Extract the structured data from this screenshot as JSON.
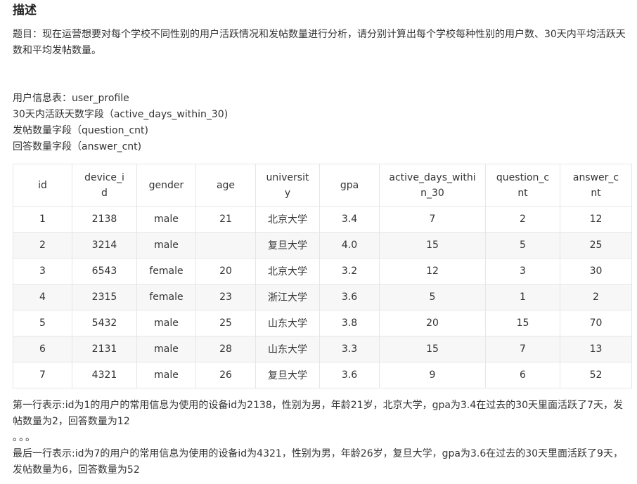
{
  "heading": "描述",
  "intro": "题目：现在运营想要对每个学校不同性别的用户活跃情况和发帖数量进行分析，请分别计算出每个学校每种性别的用户数、30天内平均活跃天数和平均发帖数量。",
  "info": {
    "line1": "用户信息表：user_profile",
    "line2": "30天内活跃天数字段（active_days_within_30)",
    "line3": "发帖数量字段（question_cnt)",
    "line4": "回答数量字段（answer_cnt)"
  },
  "table": {
    "headers": [
      "id",
      "device_id",
      "gender",
      "age",
      "university",
      "gpa",
      "active_days_within_30",
      "question_cnt",
      "answer_cnt"
    ],
    "rows": [
      [
        "1",
        "2138",
        "male",
        "21",
        "北京大学",
        "3.4",
        "7",
        "2",
        "12"
      ],
      [
        "2",
        "3214",
        "male",
        "",
        "复旦大学",
        "4.0",
        "15",
        "5",
        "25"
      ],
      [
        "3",
        "6543",
        "female",
        "20",
        "北京大学",
        "3.2",
        "12",
        "3",
        "30"
      ],
      [
        "4",
        "2315",
        "female",
        "23",
        "浙江大学",
        "3.6",
        "5",
        "1",
        "2"
      ],
      [
        "5",
        "5432",
        "male",
        "25",
        "山东大学",
        "3.8",
        "20",
        "15",
        "70"
      ],
      [
        "6",
        "2131",
        "male",
        "28",
        "山东大学",
        "3.3",
        "15",
        "7",
        "13"
      ],
      [
        "7",
        "4321",
        "male",
        "26",
        "复旦大学",
        "3.6",
        "9",
        "6",
        "52"
      ]
    ]
  },
  "notes": {
    "first": "第一行表示:id为1的用户的常用信息为使用的设备id为2138，性别为男，年龄21岁，北京大学，gpa为3.4在过去的30天里面活跃了7天，发帖数量为2，回答数量为12",
    "ellipsis": "。。。",
    "last": "最后一行表示:id为7的用户的常用信息为使用的设备id为4321，性别为男，年龄26岁，复旦大学，gpa为3.6在过去的30天里面活跃了9天，发帖数量为6，回答数量为52"
  }
}
